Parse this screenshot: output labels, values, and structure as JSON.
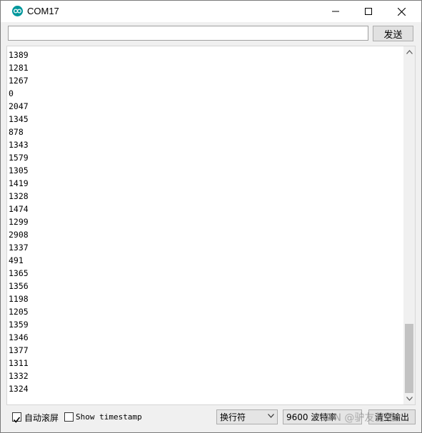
{
  "window": {
    "title": "COM17",
    "icon": "arduino-icon"
  },
  "send": {
    "input_value": "",
    "button_label": "发送"
  },
  "output": {
    "lines": [
      "1389",
      "1281",
      "1267",
      "0",
      "2047",
      "1345",
      "878",
      "1343",
      "1579",
      "1305",
      "1419",
      "1328",
      "1474",
      "1299",
      "2908",
      "1337",
      "491",
      "1365",
      "1356",
      "1198",
      "1205",
      "1359",
      "1346",
      "1377",
      "1311",
      "1332",
      "1324"
    ]
  },
  "bottom": {
    "autoscroll_label": "自动滚屏",
    "autoscroll_checked": true,
    "timestamp_label": "Show timestamp",
    "timestamp_checked": false,
    "line_ending": "换行符",
    "baud_rate": "9600 波特率",
    "clear_label": "清空输出"
  },
  "watermark": "CSDN @驴友花雕"
}
